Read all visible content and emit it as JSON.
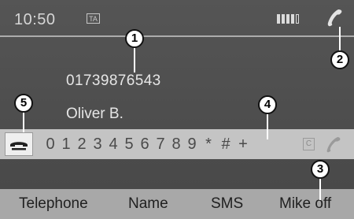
{
  "status": {
    "time": "10:50",
    "ta_label": "TA",
    "signal_bars": 4,
    "signal_max": 5
  },
  "contact": {
    "number": "01739876543",
    "name": "Oliver B."
  },
  "dialpad": {
    "keys": [
      "0",
      "1",
      "2",
      "3",
      "4",
      "5",
      "6",
      "7",
      "8",
      "9",
      "*",
      "#",
      "+"
    ],
    "clear_label": "C"
  },
  "softkeys": {
    "telephone": "Telephone",
    "name": "Name",
    "sms": "SMS",
    "mike": "Mike off"
  },
  "callouts": [
    "1",
    "2",
    "3",
    "4",
    "5"
  ]
}
